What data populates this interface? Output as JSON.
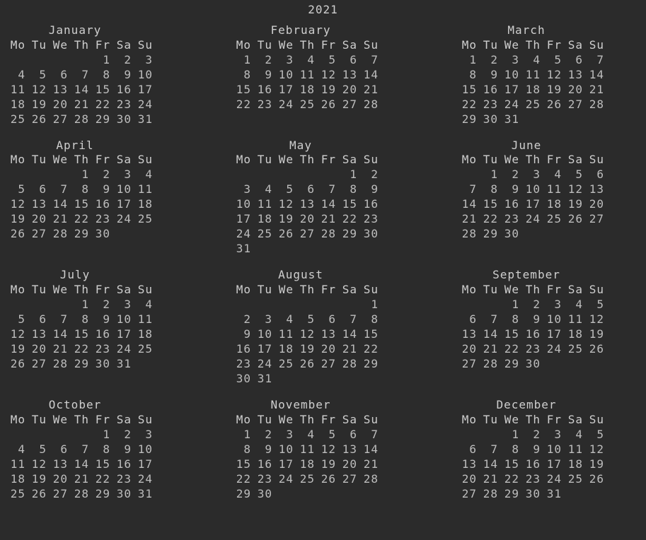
{
  "year": "2021",
  "week_header": [
    "Mo",
    "Tu",
    "We",
    "Th",
    "Fr",
    "Sa",
    "Su"
  ],
  "months": [
    {
      "name": "January",
      "weeks": [
        [
          "",
          "",
          "",
          "",
          "1",
          "2",
          "3"
        ],
        [
          "4",
          "5",
          "6",
          "7",
          "8",
          "9",
          "10"
        ],
        [
          "11",
          "12",
          "13",
          "14",
          "15",
          "16",
          "17"
        ],
        [
          "18",
          "19",
          "20",
          "21",
          "22",
          "23",
          "24"
        ],
        [
          "25",
          "26",
          "27",
          "28",
          "29",
          "30",
          "31"
        ]
      ]
    },
    {
      "name": "February",
      "weeks": [
        [
          "1",
          "2",
          "3",
          "4",
          "5",
          "6",
          "7"
        ],
        [
          "8",
          "9",
          "10",
          "11",
          "12",
          "13",
          "14"
        ],
        [
          "15",
          "16",
          "17",
          "18",
          "19",
          "20",
          "21"
        ],
        [
          "22",
          "23",
          "24",
          "25",
          "26",
          "27",
          "28"
        ]
      ]
    },
    {
      "name": "March",
      "weeks": [
        [
          "1",
          "2",
          "3",
          "4",
          "5",
          "6",
          "7"
        ],
        [
          "8",
          "9",
          "10",
          "11",
          "12",
          "13",
          "14"
        ],
        [
          "15",
          "16",
          "17",
          "18",
          "19",
          "20",
          "21"
        ],
        [
          "22",
          "23",
          "24",
          "25",
          "26",
          "27",
          "28"
        ],
        [
          "29",
          "30",
          "31",
          "",
          "",
          "",
          ""
        ]
      ]
    },
    {
      "name": "April",
      "weeks": [
        [
          "",
          "",
          "",
          "1",
          "2",
          "3",
          "4"
        ],
        [
          "5",
          "6",
          "7",
          "8",
          "9",
          "10",
          "11"
        ],
        [
          "12",
          "13",
          "14",
          "15",
          "16",
          "17",
          "18"
        ],
        [
          "19",
          "20",
          "21",
          "22",
          "23",
          "24",
          "25"
        ],
        [
          "26",
          "27",
          "28",
          "29",
          "30",
          "",
          ""
        ]
      ]
    },
    {
      "name": "May",
      "weeks": [
        [
          "",
          "",
          "",
          "",
          "",
          "1",
          "2"
        ],
        [
          "3",
          "4",
          "5",
          "6",
          "7",
          "8",
          "9"
        ],
        [
          "10",
          "11",
          "12",
          "13",
          "14",
          "15",
          "16"
        ],
        [
          "17",
          "18",
          "19",
          "20",
          "21",
          "22",
          "23"
        ],
        [
          "24",
          "25",
          "26",
          "27",
          "28",
          "29",
          "30"
        ],
        [
          "31",
          "",
          "",
          "",
          "",
          "",
          ""
        ]
      ]
    },
    {
      "name": "June",
      "weeks": [
        [
          "",
          "1",
          "2",
          "3",
          "4",
          "5",
          "6"
        ],
        [
          "7",
          "8",
          "9",
          "10",
          "11",
          "12",
          "13"
        ],
        [
          "14",
          "15",
          "16",
          "17",
          "18",
          "19",
          "20"
        ],
        [
          "21",
          "22",
          "23",
          "24",
          "25",
          "26",
          "27"
        ],
        [
          "28",
          "29",
          "30",
          "",
          "",
          "",
          ""
        ]
      ]
    },
    {
      "name": "July",
      "weeks": [
        [
          "",
          "",
          "",
          "1",
          "2",
          "3",
          "4"
        ],
        [
          "5",
          "6",
          "7",
          "8",
          "9",
          "10",
          "11"
        ],
        [
          "12",
          "13",
          "14",
          "15",
          "16",
          "17",
          "18"
        ],
        [
          "19",
          "20",
          "21",
          "22",
          "23",
          "24",
          "25"
        ],
        [
          "26",
          "27",
          "28",
          "29",
          "30",
          "31",
          ""
        ]
      ]
    },
    {
      "name": "August",
      "weeks": [
        [
          "",
          "",
          "",
          "",
          "",
          "",
          "1"
        ],
        [
          "2",
          "3",
          "4",
          "5",
          "6",
          "7",
          "8"
        ],
        [
          "9",
          "10",
          "11",
          "12",
          "13",
          "14",
          "15"
        ],
        [
          "16",
          "17",
          "18",
          "19",
          "20",
          "21",
          "22"
        ],
        [
          "23",
          "24",
          "25",
          "26",
          "27",
          "28",
          "29"
        ],
        [
          "30",
          "31",
          "",
          "",
          "",
          "",
          ""
        ]
      ]
    },
    {
      "name": "September",
      "weeks": [
        [
          "",
          "",
          "1",
          "2",
          "3",
          "4",
          "5"
        ],
        [
          "6",
          "7",
          "8",
          "9",
          "10",
          "11",
          "12"
        ],
        [
          "13",
          "14",
          "15",
          "16",
          "17",
          "18",
          "19"
        ],
        [
          "20",
          "21",
          "22",
          "23",
          "24",
          "25",
          "26"
        ],
        [
          "27",
          "28",
          "29",
          "30",
          "",
          "",
          ""
        ]
      ]
    },
    {
      "name": "October",
      "weeks": [
        [
          "",
          "",
          "",
          "",
          "1",
          "2",
          "3"
        ],
        [
          "4",
          "5",
          "6",
          "7",
          "8",
          "9",
          "10"
        ],
        [
          "11",
          "12",
          "13",
          "14",
          "15",
          "16",
          "17"
        ],
        [
          "18",
          "19",
          "20",
          "21",
          "22",
          "23",
          "24"
        ],
        [
          "25",
          "26",
          "27",
          "28",
          "29",
          "30",
          "31"
        ]
      ]
    },
    {
      "name": "November",
      "weeks": [
        [
          "1",
          "2",
          "3",
          "4",
          "5",
          "6",
          "7"
        ],
        [
          "8",
          "9",
          "10",
          "11",
          "12",
          "13",
          "14"
        ],
        [
          "15",
          "16",
          "17",
          "18",
          "19",
          "20",
          "21"
        ],
        [
          "22",
          "23",
          "24",
          "25",
          "26",
          "27",
          "28"
        ],
        [
          "29",
          "30",
          "",
          "",
          "",
          "",
          ""
        ]
      ]
    },
    {
      "name": "December",
      "weeks": [
        [
          "",
          "",
          "1",
          "2",
          "3",
          "4",
          "5"
        ],
        [
          "6",
          "7",
          "8",
          "9",
          "10",
          "11",
          "12"
        ],
        [
          "13",
          "14",
          "15",
          "16",
          "17",
          "18",
          "19"
        ],
        [
          "20",
          "21",
          "22",
          "23",
          "24",
          "25",
          "26"
        ],
        [
          "27",
          "28",
          "29",
          "30",
          "31",
          "",
          ""
        ]
      ]
    }
  ]
}
